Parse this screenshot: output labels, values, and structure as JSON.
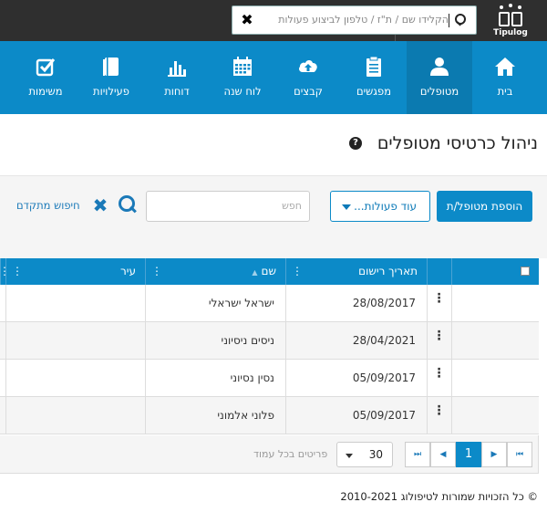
{
  "app": {
    "logo_text": "Tipulog"
  },
  "global_search": {
    "placeholder": "הקלידו שם / ת\"ז / טלפון לביצוע פעולות"
  },
  "nav": {
    "items": [
      {
        "label": "בית",
        "icon": "home-icon",
        "active": false
      },
      {
        "label": "מטופלים",
        "icon": "user-icon",
        "active": true
      },
      {
        "label": "מפגשים",
        "icon": "clipboard-icon",
        "active": false
      },
      {
        "label": "קבצים",
        "icon": "cloud-upload-icon",
        "active": false
      },
      {
        "label": "לוח שנה",
        "icon": "calendar-icon",
        "active": false
      },
      {
        "label": "דוחות",
        "icon": "bar-chart-icon",
        "active": false
      },
      {
        "label": "פעילויות",
        "icon": "book-icon",
        "active": false
      },
      {
        "label": "משימות",
        "icon": "check-square-icon",
        "active": false
      }
    ]
  },
  "page": {
    "title": "ניהול כרטיסי מטופלים",
    "help": "?"
  },
  "toolbar": {
    "add_label": "הוספת מטופל/ת",
    "actions_label": "עוד פעולות...",
    "search_placeholder": "חפש",
    "advanced_search_label": "חיפוש מתקדם"
  },
  "table": {
    "columns": [
      "תאריך רישום",
      "שם",
      "עיר"
    ],
    "rows": [
      {
        "date": "28/08/2017",
        "name": "ישראל ישראלי",
        "city": ""
      },
      {
        "date": "28/04/2021",
        "name": "ניסים ניסיוני",
        "city": ""
      },
      {
        "date": "05/09/2017",
        "name": "נסין נסיוני",
        "city": ""
      },
      {
        "date": "05/09/2017",
        "name": "פלוני אלמוני",
        "city": ""
      }
    ]
  },
  "pager": {
    "current_page": "1",
    "per_page": "30",
    "per_page_label": "פריטים בכל עמוד"
  },
  "footer": {
    "text": "© כל הזכויות שמורות לטיפולוג 2010-2021"
  },
  "colors": {
    "brand": "#0c8ac8",
    "topbar": "#2f2f2f",
    "link": "#1a79b8"
  }
}
